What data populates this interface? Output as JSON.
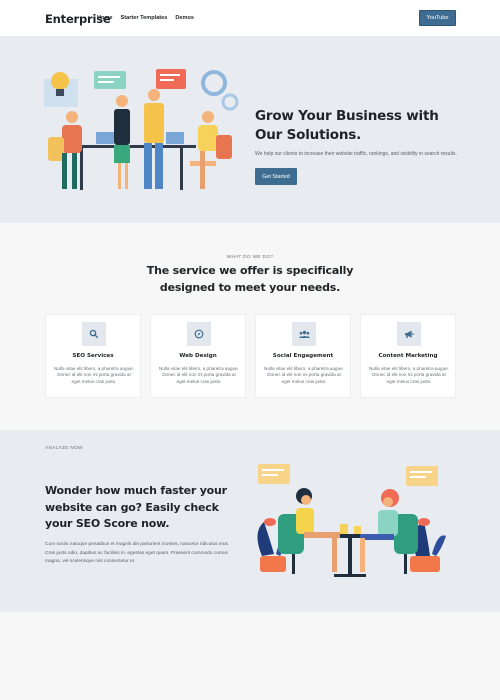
{
  "nav": {
    "brand": "Enterprise",
    "links": [
      "Home",
      "Starter Templates",
      "Demos"
    ],
    "cta": "YouTube"
  },
  "hero": {
    "title": "Grow Your Business with Our Solutions.",
    "subtitle": "We help our clients to increase their website traffic, rankings, and visibility in search results.",
    "button": "Get Started"
  },
  "services": {
    "eyebrow": "WHAT DO WE DO?",
    "title": "The service we offer is specifically designed to meet your needs.",
    "cards": [
      {
        "title": "SEO Services",
        "text": "Nulla vitae elit libero, a pharetra augue. Donec id elit non mi porta gravida at eget metus cras justo.",
        "icon": "search-icon"
      },
      {
        "title": "Web Design",
        "text": "Nulla vitae elit libero, a pharetra augue. Donec id elit non mi porta gravida at eget metus cras justo.",
        "icon": "compass-icon"
      },
      {
        "title": "Social Engagement",
        "text": "Nulla vitae elit libero, a pharetra augue. Donec id elit non mi porta gravida at eget metus cras justo.",
        "icon": "users-icon"
      },
      {
        "title": "Content Marketing",
        "text": "Nulla vitae elit libero, a pharetra augue. Donec id elit non mi porta gravida at eget metus cras justo.",
        "icon": "megaphone-icon"
      }
    ]
  },
  "analyze": {
    "eyebrow": "ANALYZE NOW",
    "title": "Wonder how much faster your website can go? Easily check your SEO Score now.",
    "text": "Cum sociis natoque penatibus et magnis dis parturient montes, nascetur ridiculus mus. Cras justo odio, dapibus ac facilisis in, egestas eget quam. Praesent commodo cursus magna, vel scelerisque nisl consectetur et."
  },
  "colors": {
    "accent": "#3f6d91",
    "section_bg": "#e8ecf0",
    "page_bg": "#f7f7f7"
  }
}
